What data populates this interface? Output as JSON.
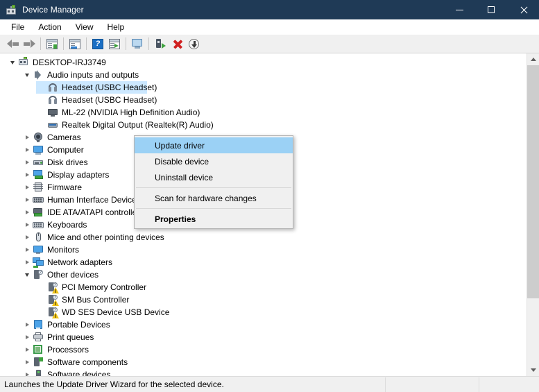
{
  "window": {
    "title": "Device Manager",
    "icon": "device-manager-icon",
    "controls": {
      "minimize": "–",
      "maximize": "☐",
      "close": "✕"
    }
  },
  "menubar": {
    "items": [
      {
        "label": "File"
      },
      {
        "label": "Action"
      },
      {
        "label": "View"
      },
      {
        "label": "Help"
      }
    ]
  },
  "toolbar": {
    "buttons": [
      {
        "name": "back-arrow-icon"
      },
      {
        "name": "forward-arrow-icon"
      },
      {
        "name": "show-hide-console-tree-icon"
      },
      {
        "name": "properties-icon"
      },
      {
        "name": "help-icon"
      },
      {
        "name": "update-driver-icon"
      },
      {
        "name": "scan-for-hardware-changes-icon"
      },
      {
        "name": "enable-device-icon"
      },
      {
        "name": "uninstall-device-icon"
      },
      {
        "name": "download-icon"
      }
    ]
  },
  "tree": {
    "nodes": [
      {
        "label": "DESKTOP-IRJ3749",
        "indent": 0,
        "twisty": "down",
        "icon": "computer-root-icon",
        "selected": false
      },
      {
        "label": "Audio inputs and outputs",
        "indent": 1,
        "twisty": "down",
        "icon": "speaker-icon",
        "selected": false
      },
      {
        "label": "Headset (USBC Headset)",
        "indent": 2,
        "twisty": "none",
        "icon": "headset-icon",
        "selected": true
      },
      {
        "label": "Headset (USBC Headset)",
        "indent": 2,
        "twisty": "none",
        "icon": "headset-icon",
        "selected": false
      },
      {
        "label": "ML-22 (NVIDIA High Definition Audio)",
        "indent": 2,
        "twisty": "none",
        "icon": "monitor-audio-icon",
        "selected": false
      },
      {
        "label": "Realtek Digital Output (Realtek(R) Audio)",
        "indent": 2,
        "twisty": "none",
        "icon": "spdif-icon",
        "selected": false
      },
      {
        "label": "Cameras",
        "indent": 1,
        "twisty": "right",
        "icon": "camera-icon",
        "selected": false
      },
      {
        "label": "Computer",
        "indent": 1,
        "twisty": "right",
        "icon": "computer-icon",
        "selected": false
      },
      {
        "label": "Disk drives",
        "indent": 1,
        "twisty": "right",
        "icon": "disk-drive-icon",
        "selected": false
      },
      {
        "label": "Display adapters",
        "indent": 1,
        "twisty": "right",
        "icon": "display-adapter-icon",
        "selected": false
      },
      {
        "label": "Firmware",
        "indent": 1,
        "twisty": "right",
        "icon": "firmware-icon",
        "selected": false
      },
      {
        "label": "Human Interface Devices",
        "indent": 1,
        "twisty": "right",
        "icon": "hid-icon",
        "selected": false
      },
      {
        "label": "IDE ATA/ATAPI controllers",
        "indent": 1,
        "twisty": "right",
        "icon": "ide-controller-icon",
        "selected": false
      },
      {
        "label": "Keyboards",
        "indent": 1,
        "twisty": "right",
        "icon": "keyboard-icon",
        "selected": false
      },
      {
        "label": "Mice and other pointing devices",
        "indent": 1,
        "twisty": "right",
        "icon": "mouse-icon",
        "selected": false
      },
      {
        "label": "Monitors",
        "indent": 1,
        "twisty": "right",
        "icon": "monitor-icon",
        "selected": false
      },
      {
        "label": "Network adapters",
        "indent": 1,
        "twisty": "right",
        "icon": "network-adapter-icon",
        "selected": false
      },
      {
        "label": "Other devices",
        "indent": 1,
        "twisty": "down",
        "icon": "other-device-icon",
        "selected": false
      },
      {
        "label": "PCI Memory Controller",
        "indent": 2,
        "twisty": "none",
        "icon": "unknown-device-warning-icon",
        "selected": false
      },
      {
        "label": "SM Bus Controller",
        "indent": 2,
        "twisty": "none",
        "icon": "unknown-device-warning-icon",
        "selected": false
      },
      {
        "label": "WD SES Device USB Device",
        "indent": 2,
        "twisty": "none",
        "icon": "unknown-device-warning-icon",
        "selected": false
      },
      {
        "label": "Portable Devices",
        "indent": 1,
        "twisty": "right",
        "icon": "portable-device-icon",
        "selected": false
      },
      {
        "label": "Print queues",
        "indent": 1,
        "twisty": "right",
        "icon": "printer-icon",
        "selected": false
      },
      {
        "label": "Processors",
        "indent": 1,
        "twisty": "right",
        "icon": "processor-icon",
        "selected": false
      },
      {
        "label": "Software components",
        "indent": 1,
        "twisty": "right",
        "icon": "software-component-icon",
        "selected": false
      },
      {
        "label": "Software devices",
        "indent": 1,
        "twisty": "right",
        "icon": "software-device-icon",
        "selected": false
      }
    ]
  },
  "context_menu": {
    "items": [
      {
        "label": "Update driver",
        "type": "item",
        "highlight": true,
        "bold": false
      },
      {
        "label": "Disable device",
        "type": "item",
        "highlight": false,
        "bold": false
      },
      {
        "label": "Uninstall device",
        "type": "item",
        "highlight": false,
        "bold": false
      },
      {
        "type": "separator"
      },
      {
        "label": "Scan for hardware changes",
        "type": "item",
        "highlight": false,
        "bold": false
      },
      {
        "type": "separator"
      },
      {
        "label": "Properties",
        "type": "item",
        "highlight": false,
        "bold": true
      }
    ]
  },
  "statusbar": {
    "message": "Launches the Update Driver Wizard for the selected device.",
    "segment2": "",
    "segment3": ""
  },
  "scrollbar": {
    "thumb_top_pct": 0,
    "thumb_height_pct": 78
  },
  "colors": {
    "titlebar": "#1f3a56",
    "selection": "#cce8ff",
    "menu_highlight": "#9bd1f5",
    "warning": "#f0c419"
  }
}
